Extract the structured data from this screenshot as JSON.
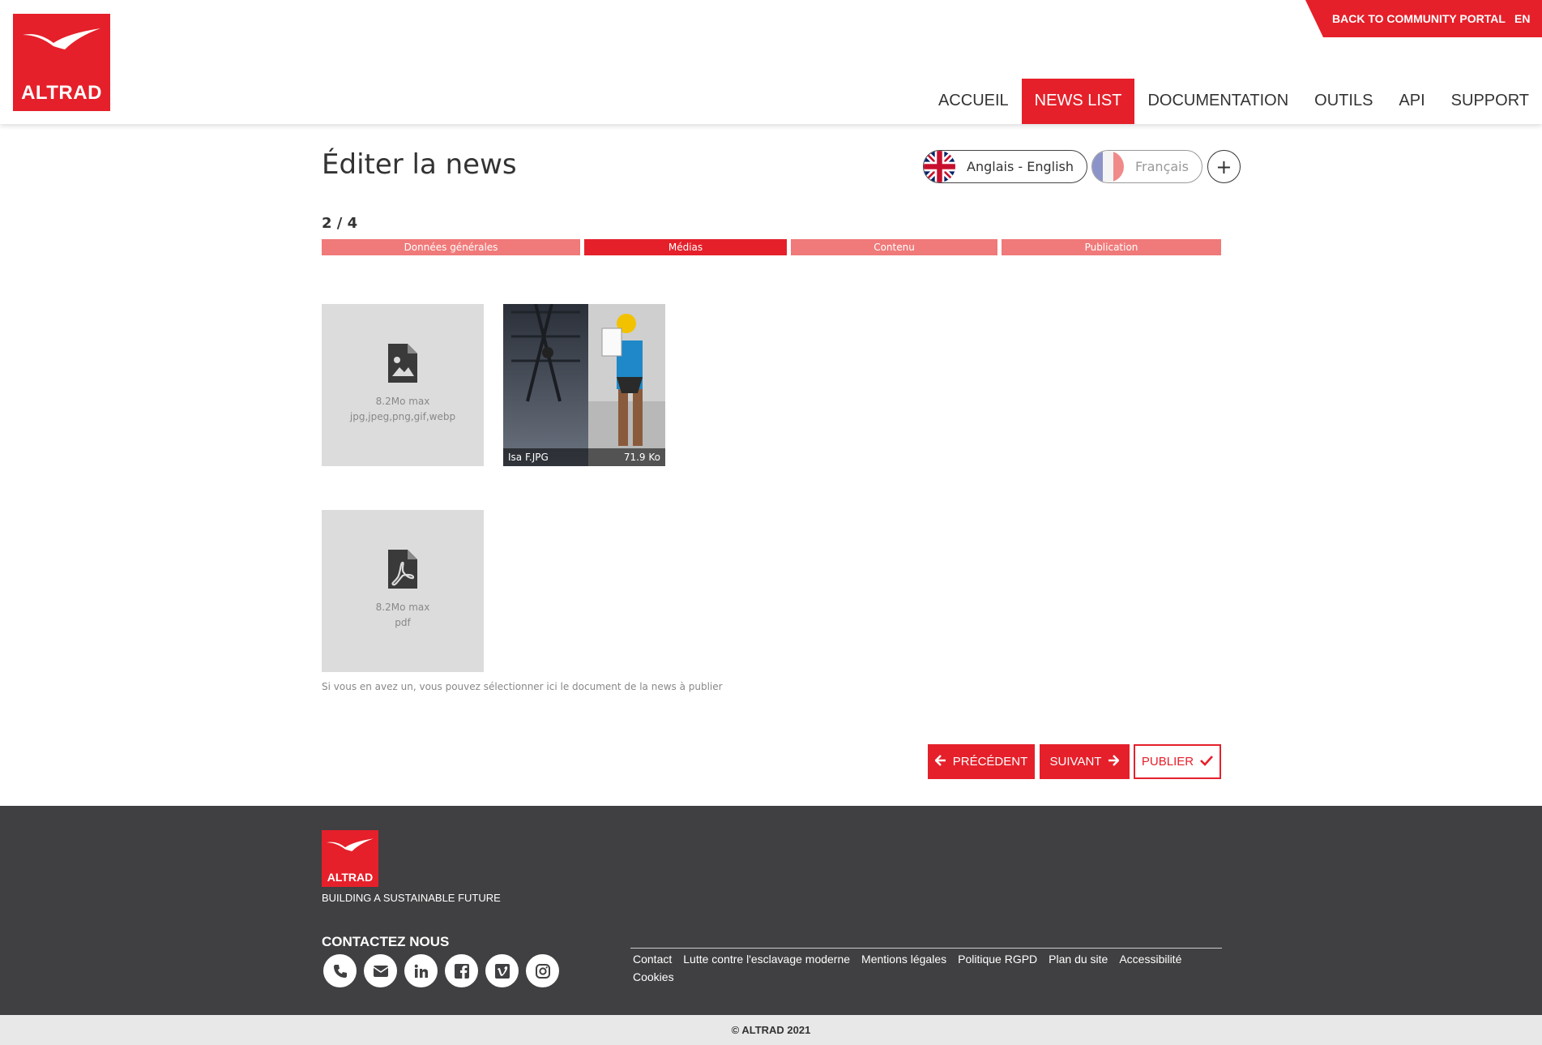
{
  "header": {
    "logo_text": "ALTRAD",
    "portal_link": "BACK TO COMMUNITY PORTAL",
    "language": "EN",
    "nav": [
      {
        "label": "ACCUEIL",
        "active": false
      },
      {
        "label": "NEWS LIST",
        "active": true
      },
      {
        "label": "DOCUMENTATION",
        "active": false
      },
      {
        "label": "OUTILS",
        "active": false
      },
      {
        "label": "API",
        "active": false
      },
      {
        "label": "SUPPORT",
        "active": false
      }
    ]
  },
  "main": {
    "title": "Éditer la news",
    "languages": [
      {
        "label": "Anglais - English",
        "active": true,
        "flag": "uk-flag-icon"
      },
      {
        "label": "Français",
        "active": false,
        "flag": "fr-flag-icon"
      }
    ],
    "add_language": "+",
    "step_counter": "2 / 4",
    "steps": [
      {
        "label": "Données générales",
        "active": false
      },
      {
        "label": "Médias",
        "active": true
      },
      {
        "label": "Contenu",
        "active": false
      },
      {
        "label": "Publication",
        "active": false
      }
    ],
    "image_upload": {
      "size": "8.2Mo max",
      "formats": "jpg,jpeg,png,gif,webp",
      "icon": "image-file-icon"
    },
    "uploaded_image": {
      "name": "Isa F.JPG",
      "size": "71.9 Ko"
    },
    "pdf_upload": {
      "size": "8.2Mo max",
      "formats": "pdf",
      "icon": "pdf-file-icon"
    },
    "pdf_help": "Si vous en avez un, vous pouvez sélectionner ici le document de la news à publier",
    "buttons": {
      "previous": "PRÉCÉDENT",
      "next": "SUIVANT",
      "publish": "PUBLIER"
    }
  },
  "footer": {
    "logo_text": "ALTRAD",
    "tagline": "BUILDING A SUSTAINABLE FUTURE",
    "contact_heading": "CONTACTEZ NOUS",
    "socials": [
      "phone-icon",
      "envelope-icon",
      "linkedin-icon",
      "facebook-icon",
      "vimeo-icon",
      "instagram-icon"
    ],
    "links": [
      "Contact",
      "Lutte contre l'esclavage moderne",
      "Mentions légales",
      "Politique RGPD",
      "Plan du site",
      "Accessibilité",
      "Cookies"
    ],
    "copyright": "© ALTRAD 2021"
  },
  "colors": {
    "brand": "#e5202a",
    "step_inactive": "#f07a7a",
    "footer_bg": "#403f41"
  }
}
